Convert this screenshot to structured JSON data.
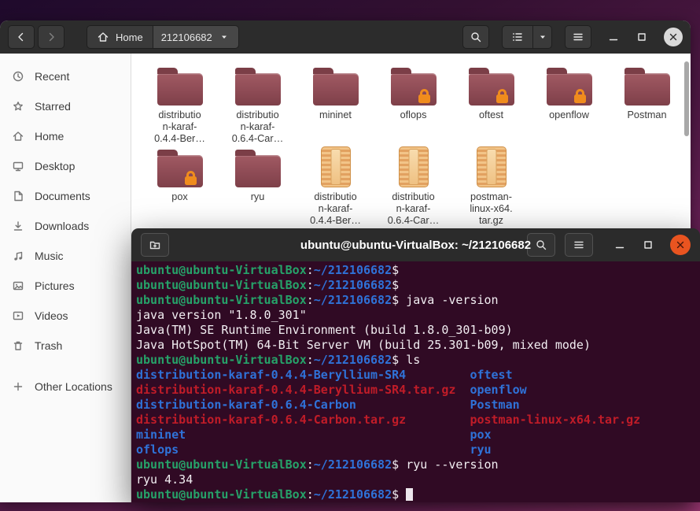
{
  "colors": {
    "accent_orange": "#e95420",
    "terminal_background": "#300a24",
    "terminal_green": "#26a269",
    "terminal_blue": "#2f72d8",
    "terminal_red": "#c01c28",
    "header_dark": "#2c2c2c",
    "folder": "#8e4b55",
    "archive": "#e8ae6b",
    "lock_badge": "#f08c1d"
  },
  "files_window": {
    "header": {
      "breadcrumb_home": "Home",
      "breadcrumb_current": "212106682",
      "icons": [
        "chevron-left",
        "chevron-right",
        "home",
        "caret-down",
        "search",
        "list",
        "menu",
        "minimize",
        "maximize",
        "close"
      ]
    },
    "sidebar": {
      "items": [
        {
          "icon": "clock",
          "label": "Recent"
        },
        {
          "icon": "star",
          "label": "Starred"
        },
        {
          "icon": "home",
          "label": "Home"
        },
        {
          "icon": "monitor",
          "label": "Desktop"
        },
        {
          "icon": "document",
          "label": "Documents"
        },
        {
          "icon": "download",
          "label": "Downloads"
        },
        {
          "icon": "music",
          "label": "Music"
        },
        {
          "icon": "image",
          "label": "Pictures"
        },
        {
          "icon": "video",
          "label": "Videos"
        },
        {
          "icon": "trash",
          "label": "Trash"
        },
        {
          "icon": "plus",
          "label": "Other Locations",
          "separated": true
        }
      ]
    },
    "grid": {
      "items": [
        {
          "name": "distribution-karaf-0.4.4-Beryllium-SR4",
          "kind": "folder",
          "lock": false,
          "label_lines": [
            "distributio",
            "n-karaf-",
            "0.4.4-Ber…"
          ]
        },
        {
          "name": "distribution-karaf-0.6.4-Carbon",
          "kind": "folder",
          "lock": false,
          "label_lines": [
            "distributio",
            "n-karaf-",
            "0.6.4-Car…"
          ]
        },
        {
          "name": "mininet",
          "kind": "folder",
          "lock": false,
          "label_lines": [
            "mininet"
          ]
        },
        {
          "name": "oflops",
          "kind": "folder",
          "lock": true,
          "label_lines": [
            "oflops"
          ]
        },
        {
          "name": "oftest",
          "kind": "folder",
          "lock": true,
          "label_lines": [
            "oftest"
          ]
        },
        {
          "name": "openflow",
          "kind": "folder",
          "lock": true,
          "label_lines": [
            "openflow"
          ]
        },
        {
          "name": "Postman",
          "kind": "folder",
          "lock": false,
          "label_lines": [
            "Postman"
          ]
        },
        {
          "name": "pox",
          "kind": "folder",
          "lock": true,
          "label_lines": [
            "pox"
          ]
        },
        {
          "name": "ryu",
          "kind": "folder",
          "lock": false,
          "label_lines": [
            "ryu"
          ]
        },
        {
          "name": "distribution-karaf-0.4.4-Beryllium-SR4.tar.gz",
          "kind": "archive",
          "lock": false,
          "label_lines": [
            "distributio",
            "n-karaf-",
            "0.4.4-Ber…"
          ]
        },
        {
          "name": "distribution-karaf-0.6.4-Carbon.tar.gz",
          "kind": "archive",
          "lock": false,
          "label_lines": [
            "distributio",
            "n-karaf-",
            "0.6.4-Car…"
          ]
        },
        {
          "name": "postman-linux-x64.tar.gz",
          "kind": "archive",
          "lock": false,
          "label_lines": [
            "postman-",
            "linux-x64.",
            "tar.gz"
          ]
        }
      ]
    }
  },
  "terminal": {
    "title": "ubuntu@ubuntu-VirtualBox: ~/212106682",
    "header_icons": [
      "tab-new",
      "search",
      "menu",
      "minimize",
      "maximize",
      "close"
    ],
    "prompt": {
      "user": "ubuntu@ubuntu-VirtualBox",
      "separator": ":",
      "path": "~/212106682",
      "symbol": "$"
    },
    "lines": [
      {
        "type": "prompt",
        "cmd": ""
      },
      {
        "type": "prompt",
        "cmd": ""
      },
      {
        "type": "prompt",
        "cmd": "java -version"
      },
      {
        "type": "out",
        "text": "java version \"1.8.0_301\""
      },
      {
        "type": "out",
        "text": "Java(TM) SE Runtime Environment (build 1.8.0_301-b09)"
      },
      {
        "type": "out",
        "text": "Java HotSpot(TM) 64-Bit Server VM (build 25.301-b09, mixed mode)"
      },
      {
        "type": "prompt",
        "cmd": "ls"
      },
      {
        "type": "cols",
        "c1": "distribution-karaf-0.4.4-Beryllium-SR4",
        "s1": "dir",
        "c2": "oftest",
        "s2": "dir"
      },
      {
        "type": "cols",
        "c1": "distribution-karaf-0.4.4-Beryllium-SR4.tar.gz",
        "s1": "arc",
        "c2": "openflow",
        "s2": "dir"
      },
      {
        "type": "cols",
        "c1": "distribution-karaf-0.6.4-Carbon",
        "s1": "dir",
        "c2": "Postman",
        "s2": "dir"
      },
      {
        "type": "cols",
        "c1": "distribution-karaf-0.6.4-Carbon.tar.gz",
        "s1": "arc",
        "c2": "postman-linux-x64.tar.gz",
        "s2": "arc"
      },
      {
        "type": "cols",
        "c1": "mininet",
        "s1": "dir",
        "c2": "pox",
        "s2": "dir"
      },
      {
        "type": "cols",
        "c1": "oflops",
        "s1": "dir",
        "c2": "ryu",
        "s2": "dir"
      },
      {
        "type": "prompt",
        "cmd": "ryu --version"
      },
      {
        "type": "out",
        "text": "ryu 4.34"
      },
      {
        "type": "prompt",
        "cmd": "",
        "cursor": true
      }
    ]
  }
}
